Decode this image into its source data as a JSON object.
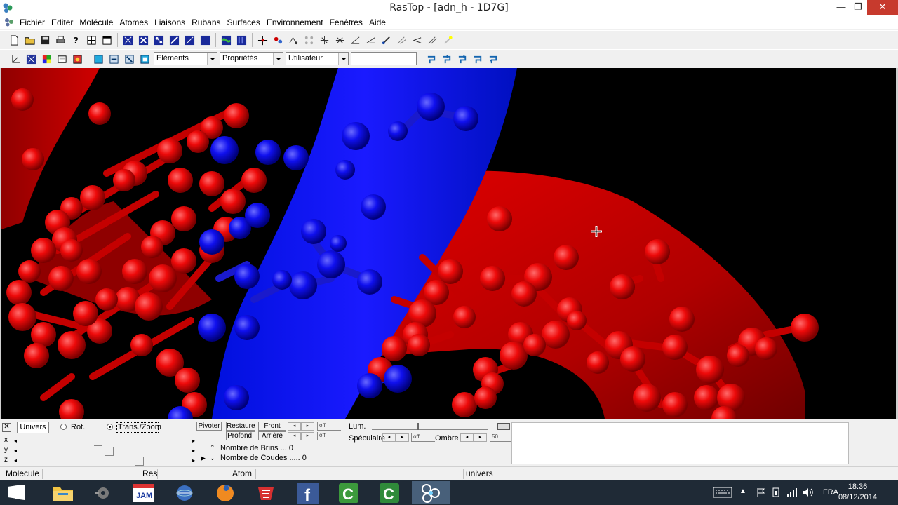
{
  "window": {
    "title": "RasTop - [adn_h - 1D7G]",
    "min_glyph": "—",
    "max_glyph": "❐",
    "close_glyph": "✕"
  },
  "menu": [
    "Fichier",
    "Editer",
    "Molécule",
    "Atomes",
    "Liaisons",
    "Rubans",
    "Surfaces",
    "Environnement",
    "Fenêtres",
    "Aide"
  ],
  "mdi_buttons": [
    "_",
    "❐",
    "✕"
  ],
  "toolbar2": {
    "elements_combo": "Eléments",
    "props_combo": "Propriétés",
    "user_combo": "Utilisateur",
    "text_value": ""
  },
  "panel": {
    "close": "✕",
    "tab_univers": "Univers",
    "radio_rot": "Rot.",
    "radio_trans": "Trans./Zoom",
    "axes": [
      "x",
      "y",
      "z"
    ],
    "axis_positions": [
      0.45,
      0.52,
      0.71
    ],
    "btn_pivoter": "Pivoter",
    "btn_restaure": "Restaure",
    "btn_front": "Front",
    "btn_profond": "Profond.",
    "btn_arriere": "Arrière",
    "off1": "off",
    "off2": "off",
    "off3": "off",
    "lum_label": "Lum.",
    "lum_position": 0.39,
    "specular_label": "Spéculaire",
    "ombre_label": "Ombre",
    "ombre_value": "50",
    "brins_label": "Nombre de Brins ... 0",
    "coudes_label": "Nombre de Coudes ..... 0"
  },
  "status": {
    "molecule": "Molecule",
    "res": "Res",
    "atom": "Atom",
    "univers": "univers"
  },
  "taskbar": {
    "lang": "FRA",
    "time": "18:36",
    "date": "08/12/2014"
  },
  "colors": {
    "strand_red": "#cc0000",
    "strand_blue": "#0000ee",
    "atom_red": "#ff1a1a",
    "atom_blue": "#1a1aff",
    "background": "#000000"
  }
}
